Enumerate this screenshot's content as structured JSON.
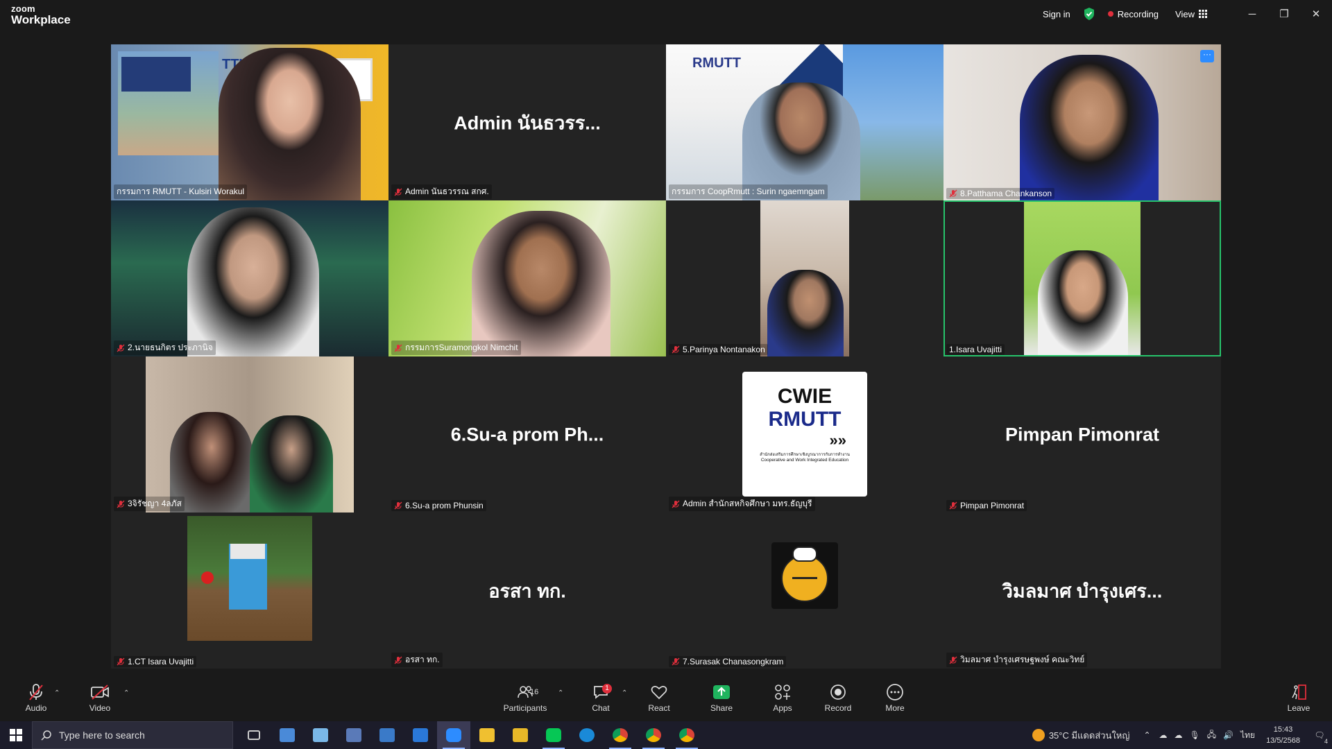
{
  "app": {
    "logo_line1": "zoom",
    "logo_line2": "Workplace"
  },
  "titlebar": {
    "sign_in": "Sign in",
    "recording": "Recording",
    "view": "View",
    "minimize": "─",
    "restore": "❐",
    "close": "✕"
  },
  "tiles": [
    {
      "label": "กรรมการ RMUTT - Kulsiri Worakul",
      "muted": false,
      "big": ""
    },
    {
      "label": "Admin นันธวรรณ สกศ.",
      "muted": true,
      "big": "Admin นันธวรร..."
    },
    {
      "label": "กรรมการ CoopRmutt : Surin ngaemngam",
      "muted": false,
      "big": ""
    },
    {
      "label": "8.Patthama Chankanson",
      "muted": true,
      "big": ""
    },
    {
      "label": "2.นายธนกิตร ประภานิจ",
      "muted": true,
      "big": ""
    },
    {
      "label": "กรรมการSuramongkol Nimchit",
      "muted": true,
      "big": ""
    },
    {
      "label": "5.Parinya Nontanakon",
      "muted": true,
      "big": ""
    },
    {
      "label": "1.Isara Uvajitti",
      "muted": false,
      "big": ""
    },
    {
      "label": "3จิรัชญา 4ลภัส",
      "muted": true,
      "big": ""
    },
    {
      "label": "6.Su-a prom Phunsin",
      "muted": true,
      "big": "6.Su-a prom Ph..."
    },
    {
      "label": "Admin สำนักสหกิจศึกษา มทร.ธัญบุรี",
      "muted": true,
      "big": ""
    },
    {
      "label": "Pimpan Pimonrat",
      "muted": true,
      "big": "Pimpan Pimonrat"
    },
    {
      "label": "1.CT Isara Uvajitti",
      "muted": true,
      "big": ""
    },
    {
      "label": "อรสา ทก.",
      "muted": true,
      "big": "อรสา ทก."
    },
    {
      "label": "7.Surasak Chanasongkram",
      "muted": true,
      "big": ""
    },
    {
      "label": "วิมลมาศ บำรุงเศรษฐพงษ์ คณะวิทย์",
      "muted": true,
      "big": "วิมลมาศ บำรุงเศร..."
    }
  ],
  "tile_text": {
    "tt_logo": "TTU",
    "rmutt_logo": "RMUTT",
    "cwie_line1": "CWIE",
    "cwie_line2": "RMUTT",
    "cwie_sub1": "สำนักส่งเสริมการศึกษาเชิงบูรณาการกับการทำงาน",
    "cwie_sub2": "Cooperative and Work Integrated Education"
  },
  "toolbar": {
    "audio": "Audio",
    "video": "Video",
    "participants": "Participants",
    "participants_count": "16",
    "chat": "Chat",
    "chat_badge": "1",
    "react": "React",
    "share": "Share",
    "apps": "Apps",
    "record": "Record",
    "more": "More",
    "leave": "Leave"
  },
  "taskbar": {
    "search_placeholder": "Type here to search",
    "weather": "35°C มีแดดส่วนใหญ่",
    "lang": "ไทย",
    "time": "15:43",
    "date": "13/5/2568",
    "notif_count": "4"
  },
  "colors": {
    "accent": "#2d8cff",
    "active_speaker": "#27c46b",
    "recording": "#e02f3c",
    "share": "#1fb45e"
  }
}
